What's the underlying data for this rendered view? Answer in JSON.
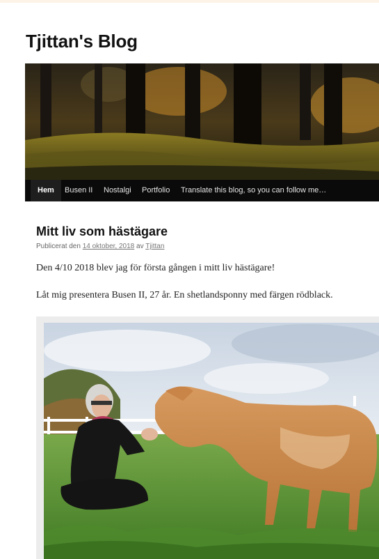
{
  "site": {
    "title": "Tjittan's Blog"
  },
  "nav": {
    "items": [
      {
        "label": "Hem",
        "active": true
      },
      {
        "label": "Busen II"
      },
      {
        "label": "Nostalgi"
      },
      {
        "label": "Portfolio"
      },
      {
        "label": "Translate this blog, so you can follow me…"
      }
    ]
  },
  "post": {
    "title": "Mitt liv som hästägare",
    "meta": {
      "prefix": "Publicerat den",
      "date": "14 oktober, 2018",
      "by": "av",
      "author": "Tjittan"
    },
    "paragraphs": [
      "Den 4/10 2018 blev jag för första gången i mitt liv hästägare!",
      "Låt mig presentera Busen II, 27 år. En shetlandsponny med färgen rödblack."
    ]
  },
  "colors": {
    "nav_bg": "#0a0a0a",
    "nav_text": "#e6e6e6",
    "title": "#111111",
    "meta": "#666666"
  }
}
